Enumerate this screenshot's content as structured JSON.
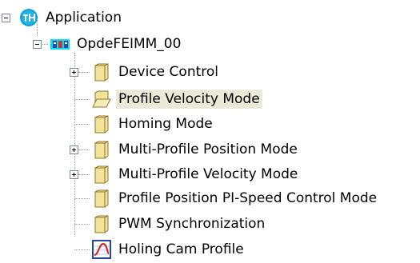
{
  "tree": {
    "root": {
      "label": "Application",
      "icon": "application-icon",
      "expanded": true
    },
    "device": {
      "label": "OpdeFEIMM_00",
      "icon": "device-icon",
      "expanded": true
    },
    "children": [
      {
        "label": "Device Control",
        "icon": "folder-closed-icon",
        "expandable": true
      },
      {
        "label": "Profile Velocity Mode",
        "icon": "folder-open-icon",
        "expandable": false,
        "selected": true
      },
      {
        "label": "Homing Mode",
        "icon": "folder-closed-icon",
        "expandable": false
      },
      {
        "label": "Multi-Profile Position Mode",
        "icon": "folder-closed-icon",
        "expandable": true
      },
      {
        "label": "Multi-Profile Velocity Mode",
        "icon": "folder-closed-icon",
        "expandable": true
      },
      {
        "label": "Profile Position PI-Speed Control Mode",
        "icon": "folder-closed-icon",
        "expandable": false
      },
      {
        "label": "PWM Synchronization",
        "icon": "folder-closed-icon",
        "expandable": false
      },
      {
        "label": "Holing Cam Profile",
        "icon": "cam-profile-icon",
        "expandable": false
      }
    ]
  },
  "colors": {
    "selection": "#ece9d8",
    "folder": "#f3e39a",
    "application_icon": "#0aa0d8",
    "device_icon_highlight": "#00e0f0"
  }
}
